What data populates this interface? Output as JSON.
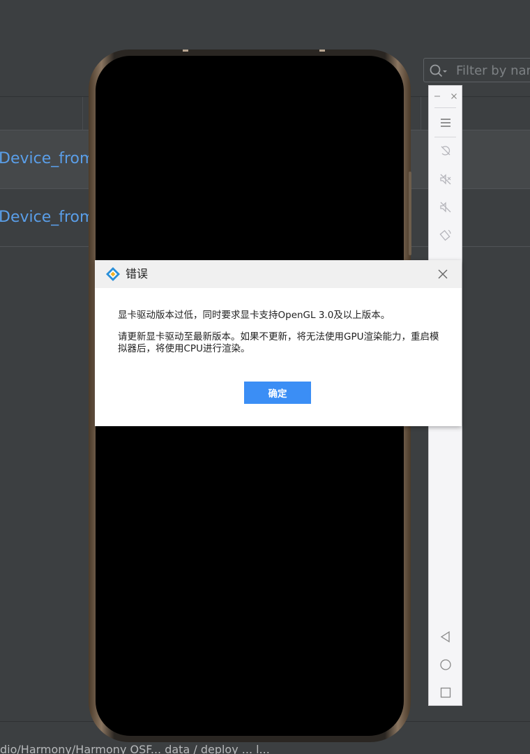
{
  "background": {
    "rows": [
      {
        "name": "Device_from"
      },
      {
        "name": "Device_from"
      }
    ],
    "status_path": "dio/Harmony/Harmony OSF... data / deploy ... l..."
  },
  "search": {
    "placeholder": "Filter by name",
    "icon": "search-icon"
  },
  "toolbar": {
    "window_controls": [
      "minimize-icon",
      "close-icon"
    ],
    "items": [
      {
        "icon": "menu-icon"
      },
      {
        "icon": "rotate-disabled-icon"
      },
      {
        "icon": "volume-mute-disabled-icon"
      },
      {
        "icon": "volume-mute-icon"
      },
      {
        "icon": "rotate-screen-icon"
      }
    ],
    "nav": [
      {
        "icon": "back-icon"
      },
      {
        "icon": "home-icon"
      },
      {
        "icon": "recent-apps-icon"
      }
    ]
  },
  "dialog": {
    "title": "错误",
    "message_line1": "显卡驱动版本过低，同时要求显卡支持OpenGL 3.0及以上版本。",
    "message_line2": "请更新显卡驱动至最新版本。如果不更新，将无法使用GPU渲染能力，重启模拟器后，将使用CPU进行渲染。",
    "ok_label": "确定",
    "accent_color": "#3b8ef5"
  }
}
